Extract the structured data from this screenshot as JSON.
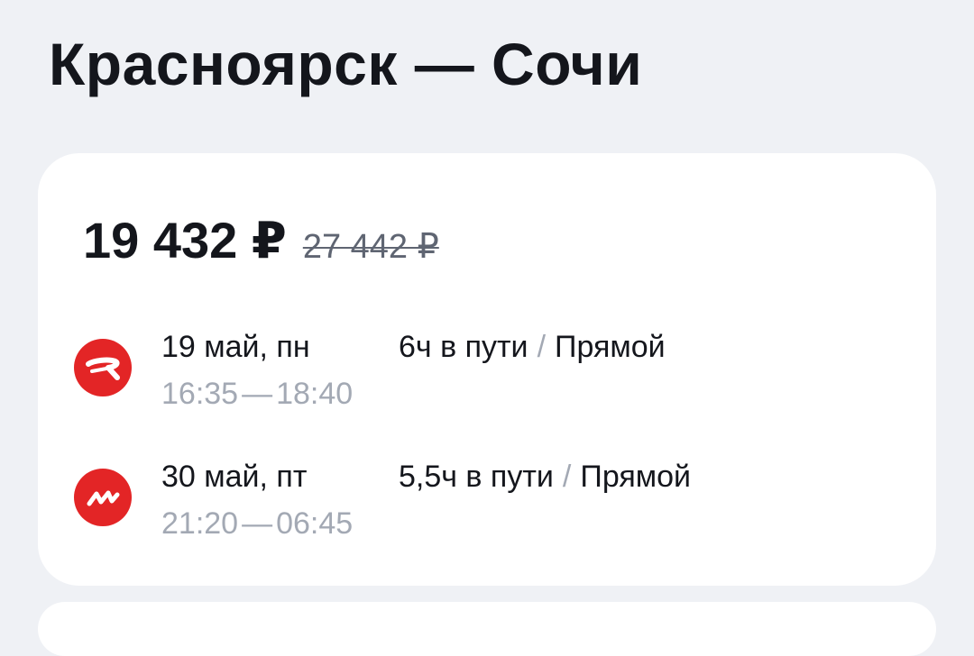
{
  "route": {
    "title": "Красноярск — Сочи"
  },
  "offer": {
    "price": "19 432 ₽",
    "old_price": "27 442 ₽",
    "segments": [
      {
        "airline_icon": "red-wings-logo-icon",
        "date": "19 май, пн",
        "depart": "16:35",
        "dash": "—",
        "arrive": "18:40",
        "duration": "6ч в пути",
        "separator": "/",
        "stops": "Прямой"
      },
      {
        "airline_icon": "nordwind-logo-icon",
        "date": "30 май, пт",
        "depart": "21:20",
        "dash": "—",
        "arrive": "06:45",
        "duration": "5,5ч в пути",
        "separator": "/",
        "stops": "Прямой"
      }
    ]
  },
  "colors": {
    "background": "#eff1f5",
    "card": "#ffffff",
    "brand_red": "#e32526",
    "muted": "#a3a9b4"
  }
}
